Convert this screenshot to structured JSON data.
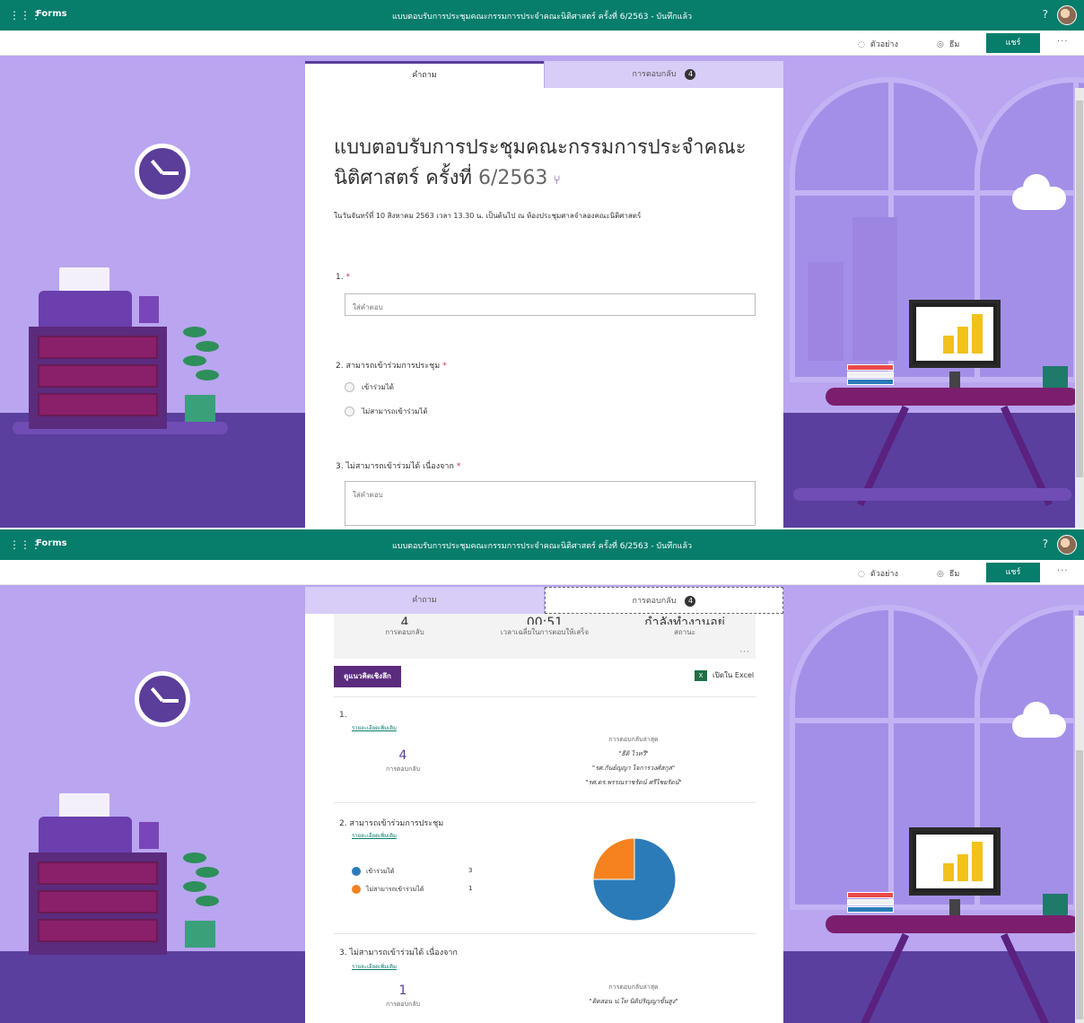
{
  "app": {
    "name": "Forms",
    "doc_title": "แบบตอบรับการประชุมคณะกรรมการประจำคณะนิติศาสตร์ ครั้งที่ 6/2563 - บันทึกแล้ว",
    "help": "?",
    "waffle": "⋮⋮⋮"
  },
  "toolbar": {
    "preview_label": "ตัวอย่าง",
    "theme_label": "ธีม",
    "share_label": "แชร์",
    "more": "···",
    "preview_icon": "eye-icon",
    "theme_icon": "palette-icon"
  },
  "tabs": {
    "questions_label": "คำถาม",
    "responses_label": "การตอบกลับ",
    "responses_count": "4"
  },
  "form": {
    "title_main": "แบบตอบรับการประชุมคณะกรรมการประจำคณะนิติศาสตร์ ครั้งที่",
    "title_num": "6/2563",
    "branch_icon": "⑂",
    "description": "ในวันจันทร์ที่ 10 สิงหาคม  2563  เวลา 13.30 น. เป็นต้นไป ณ ห้องประชุมศาลจำลองคณะนิติศาสตร์",
    "required_mark": "*",
    "questions": [
      {
        "label": "1.",
        "placeholder": "ใส่คำตอบ"
      },
      {
        "label": "2. สามารถเข้าร่วมการประชุม",
        "options": [
          "เข้าร่วมได้",
          "ไม่สามารถเข้าร่วมได้"
        ]
      },
      {
        "label": "3. ไม่สามารถเข้าร่วมได้ เนื่องจาก",
        "placeholder": "ใส่คำตอบ"
      }
    ]
  },
  "responses": {
    "summary": [
      {
        "value": "4",
        "label": "การตอบกลับ"
      },
      {
        "value": "00:51",
        "label": "เวลาเฉลี่ยในการตอบให้เสร็จ"
      },
      {
        "value": "กำลังทำงานอยู่",
        "label": "สถานะ"
      }
    ],
    "summary_more": "···",
    "insights_label": "ดูแนวคิดเชิงลึก",
    "excel_label": "เปิดใน Excel",
    "excel_icon_text": "X",
    "details_label": "รายละเอียดเพิ่มเติม",
    "latest_label": "การตอบกลับล่าสุด",
    "count_label": "การตอบกลับ",
    "q1": {
      "label": "1.",
      "count": "4",
      "latest": [
        "\"ธีติ ไวทวี\"",
        "\"รศ.กันย์ญญา ไจการวงศ์สกุล\"",
        "\"รศ.ดร.พรรณราชรัตน์ ศรีไชยรัตน์\""
      ]
    },
    "q2": {
      "label": "2.  สามารถเข้าร่วมการประชุม",
      "legend": [
        {
          "name": "เข้าร่วมได้",
          "count": "3",
          "color": "#2b7bb9"
        },
        {
          "name": "ไม่สามารถเข้าร่วมได้",
          "count": "1",
          "color": "#f5821f"
        }
      ]
    },
    "q3": {
      "label": "3.  ไม่สามารถเข้าร่วมได้ เนื่องจาก",
      "count": "1",
      "latest": [
        "\"ติดสอน ป.โท นิติปริญญาขั้นสูง\""
      ]
    }
  },
  "chart_data": {
    "type": "pie",
    "categories": [
      "เข้าร่วมได้",
      "ไม่สามารถเข้าร่วมได้"
    ],
    "values": [
      3,
      1
    ],
    "colors": [
      "#2b7bb9",
      "#f5821f"
    ]
  }
}
